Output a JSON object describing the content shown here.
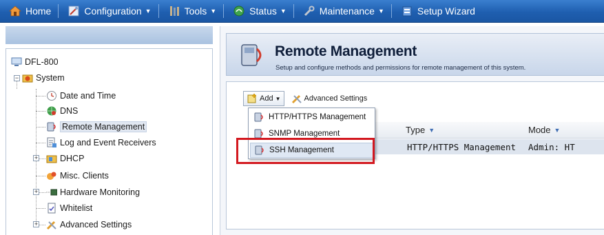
{
  "menubar": {
    "items": [
      {
        "label": "Home",
        "icon": "home-icon",
        "has_caret": false
      },
      {
        "label": "Configuration",
        "icon": "configuration-icon",
        "has_caret": true
      },
      {
        "label": "Tools",
        "icon": "tools-icon",
        "has_caret": true
      },
      {
        "label": "Status",
        "icon": "status-icon",
        "has_caret": true
      },
      {
        "label": "Maintenance",
        "icon": "maintenance-icon",
        "has_caret": true
      },
      {
        "label": "Setup Wizard",
        "icon": "setup-wizard-icon",
        "has_caret": false
      }
    ]
  },
  "tree": {
    "root": "DFL-800",
    "system": "System",
    "items": [
      {
        "label": "Date and Time",
        "icon": "clock-icon"
      },
      {
        "label": "DNS",
        "icon": "dns-icon"
      },
      {
        "label": "Remote Management",
        "icon": "remote-management-icon",
        "selected": true
      },
      {
        "label": "Log and Event Receivers",
        "icon": "log-receivers-icon"
      },
      {
        "label": "DHCP",
        "icon": "dhcp-icon",
        "expandable": true
      },
      {
        "label": "Misc. Clients",
        "icon": "misc-clients-icon"
      },
      {
        "label": "Hardware Monitoring",
        "icon": "hardware-monitoring-icon",
        "expandable": true
      },
      {
        "label": "Whitelist",
        "icon": "whitelist-icon"
      },
      {
        "label": "Advanced Settings",
        "icon": "advanced-settings-icon",
        "expandable": true
      }
    ]
  },
  "panel": {
    "title": "Remote Management",
    "description": "Setup and configure methods and permissions for remote management of this system."
  },
  "toolbar": {
    "add_label": "Add",
    "advanced_label": "Advanced Settings"
  },
  "add_menu": {
    "items": [
      {
        "label": "HTTP/HTTPS Management"
      },
      {
        "label": "SNMP Management"
      },
      {
        "label": "SSH Management",
        "hovered": true
      }
    ]
  },
  "grid": {
    "columns": [
      {
        "label": "Type"
      },
      {
        "label": "Mode"
      }
    ],
    "rows": [
      {
        "type": "HTTP/HTTPS Management",
        "mode": "Admin: HT"
      }
    ]
  },
  "colors": {
    "menubar": "#1f5fb0",
    "highlight": "#d3181f"
  }
}
